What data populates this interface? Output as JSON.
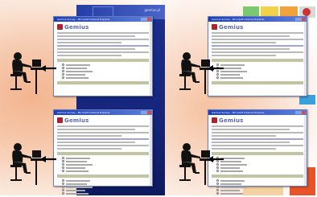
{
  "scene": {
    "brand_name": "Gemius",
    "window_title": "Gemius Survey - Microsoft Internet Explorer",
    "blue_banner_text": "gemius.pl",
    "colors": {
      "brand_red": "#b21f2d",
      "brand_blue": "#5a6aa6",
      "titlebar_blue": "#1b3fb8",
      "question_bar": "#c2c4a2",
      "backdrop_blue": "#1c2f8f"
    }
  },
  "panels": [
    {
      "id": "top-left"
    },
    {
      "id": "bottom-left"
    },
    {
      "id": "top-right"
    },
    {
      "id": "bottom-right"
    }
  ],
  "icons": [
    "person-at-computer-icon",
    "arrow-left-icon"
  ]
}
